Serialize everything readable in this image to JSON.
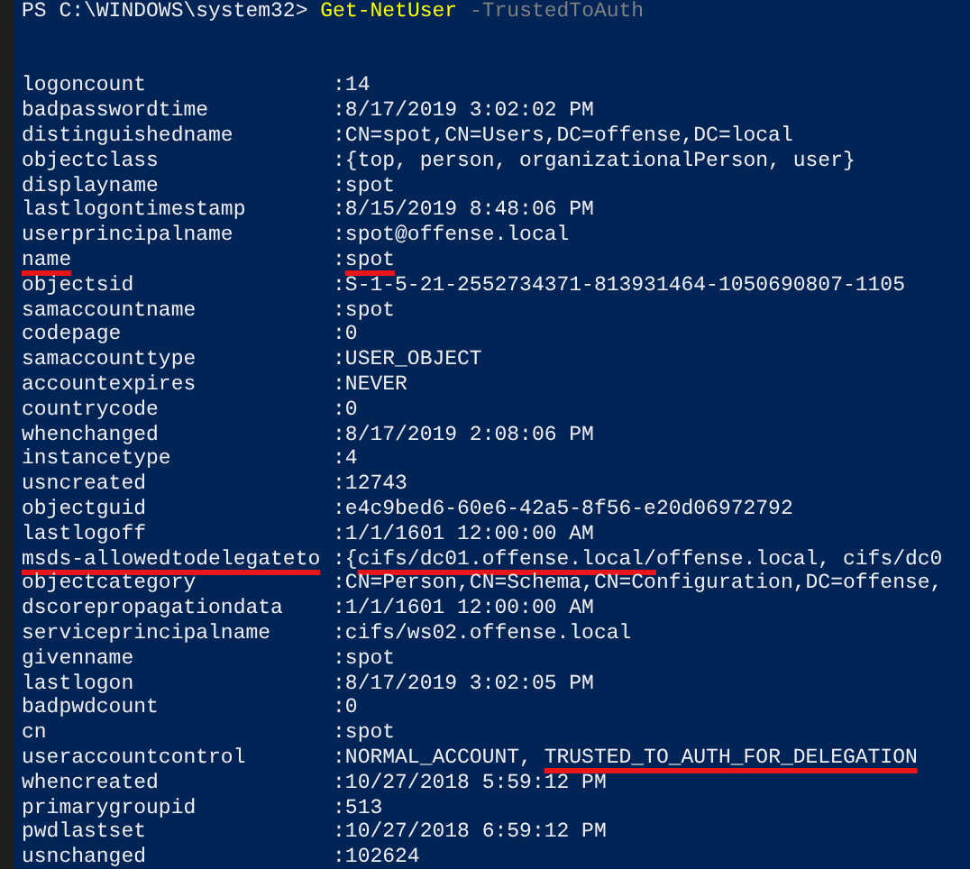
{
  "prompt": [
    {
      "kind": "prompt",
      "text": "PS C:\\WINDOWS\\system32> "
    },
    {
      "kind": "command",
      "text": "Get-NetUser"
    },
    {
      "kind": "parameter",
      "text": " -TrustedToAuth"
    }
  ],
  "rows": [
    {
      "label": "logoncount",
      "separator": ":",
      "value": [
        {
          "text": "14",
          "marked": false
        }
      ],
      "label_marked": false
    },
    {
      "label": "badpasswordtime",
      "separator": ":",
      "value": [
        {
          "text": "8/17/2019 3:02:02 PM",
          "marked": false
        }
      ],
      "label_marked": false
    },
    {
      "label": "distinguishedname",
      "separator": ":",
      "value": [
        {
          "text": "CN=spot,CN=Users,DC=offense,DC=local",
          "marked": false
        }
      ],
      "label_marked": false
    },
    {
      "label": "objectclass",
      "separator": ":",
      "value": [
        {
          "text": "{top, person, organizationalPerson, user}",
          "marked": false
        }
      ],
      "label_marked": false
    },
    {
      "label": "displayname",
      "separator": ":",
      "value": [
        {
          "text": "spot",
          "marked": false
        }
      ],
      "label_marked": false
    },
    {
      "label": "lastlogontimestamp",
      "separator": ":",
      "value": [
        {
          "text": "8/15/2019 8:48:06 PM",
          "marked": false
        }
      ],
      "label_marked": false
    },
    {
      "label": "userprincipalname",
      "separator": ":",
      "value": [
        {
          "text": "spot@offense.local",
          "marked": false
        }
      ],
      "label_marked": false
    },
    {
      "label": "name",
      "separator": ":",
      "value": [
        {
          "text": "spot",
          "marked": true
        }
      ],
      "label_marked": true
    },
    {
      "label": "objectsid",
      "separator": ":",
      "value": [
        {
          "text": "S-1-5-21-2552734371-813931464-1050690807-1105",
          "marked": false
        }
      ],
      "label_marked": false
    },
    {
      "label": "samaccountname",
      "separator": ":",
      "value": [
        {
          "text": "spot",
          "marked": false
        }
      ],
      "label_marked": false
    },
    {
      "label": "codepage",
      "separator": ":",
      "value": [
        {
          "text": "0",
          "marked": false
        }
      ],
      "label_marked": false
    },
    {
      "label": "samaccounttype",
      "separator": ":",
      "value": [
        {
          "text": "USER_OBJECT",
          "marked": false
        }
      ],
      "label_marked": false
    },
    {
      "label": "accountexpires",
      "separator": ":",
      "value": [
        {
          "text": "NEVER",
          "marked": false
        }
      ],
      "label_marked": false
    },
    {
      "label": "countrycode",
      "separator": ":",
      "value": [
        {
          "text": "0",
          "marked": false
        }
      ],
      "label_marked": false
    },
    {
      "label": "whenchanged",
      "separator": ":",
      "value": [
        {
          "text": "8/17/2019 2:08:06 PM",
          "marked": false
        }
      ],
      "label_marked": false
    },
    {
      "label": "instancetype",
      "separator": ":",
      "value": [
        {
          "text": "4",
          "marked": false
        }
      ],
      "label_marked": false
    },
    {
      "label": "usncreated",
      "separator": ":",
      "value": [
        {
          "text": "12743",
          "marked": false
        }
      ],
      "label_marked": false
    },
    {
      "label": "objectguid",
      "separator": ":",
      "value": [
        {
          "text": "e4c9bed6-60e6-42a5-8f56-e20d06972792",
          "marked": false
        }
      ],
      "label_marked": false
    },
    {
      "label": "lastlogoff",
      "separator": ":",
      "value": [
        {
          "text": "1/1/1601 12:00:00 AM",
          "marked": false
        }
      ],
      "label_marked": false
    },
    {
      "label": "msds-allowedtodelegateto",
      "separator": ":",
      "value": [
        {
          "text": "{",
          "marked": false
        },
        {
          "text": "cifs/dc01.offense.local/",
          "marked": true
        },
        {
          "text": "offense.local, cifs/dc0",
          "marked": false
        }
      ],
      "label_marked": true
    },
    {
      "label": "objectcategory",
      "separator": ":",
      "value": [
        {
          "text": "CN=Person,CN=Schema,CN=Configuration,DC=offense,",
          "marked": false
        }
      ],
      "label_marked": false
    },
    {
      "label": "dscorepropagationdata",
      "separator": ":",
      "value": [
        {
          "text": "1/1/1601 12:00:00 AM",
          "marked": false
        }
      ],
      "label_marked": false
    },
    {
      "label": "serviceprincipalname",
      "separator": ":",
      "value": [
        {
          "text": "cifs/ws02.offense.local",
          "marked": false
        }
      ],
      "label_marked": false
    },
    {
      "label": "givenname",
      "separator": ":",
      "value": [
        {
          "text": "spot",
          "marked": false
        }
      ],
      "label_marked": false
    },
    {
      "label": "lastlogon",
      "separator": ":",
      "value": [
        {
          "text": "8/17/2019 3:02:05 PM",
          "marked": false
        }
      ],
      "label_marked": false
    },
    {
      "label": "badpwdcount",
      "separator": ":",
      "value": [
        {
          "text": "0",
          "marked": false
        }
      ],
      "label_marked": false
    },
    {
      "label": "cn",
      "separator": ":",
      "value": [
        {
          "text": "spot",
          "marked": false
        }
      ],
      "label_marked": false
    },
    {
      "label": "useraccountcontrol",
      "separator": ":",
      "value": [
        {
          "text": "NORMAL_ACCOUNT, ",
          "marked": false
        },
        {
          "text": "TRUSTED_TO_AUTH_FOR_DELEGATION",
          "marked": true
        }
      ],
      "label_marked": false
    },
    {
      "label": "whencreated",
      "separator": ":",
      "value": [
        {
          "text": "10/27/2018 5:59:12 PM",
          "marked": false
        }
      ],
      "label_marked": false
    },
    {
      "label": "primarygroupid",
      "separator": ":",
      "value": [
        {
          "text": "513",
          "marked": false
        }
      ],
      "label_marked": false
    },
    {
      "label": "pwdlastset",
      "separator": ":",
      "value": [
        {
          "text": "10/27/2018 6:59:12 PM",
          "marked": false
        }
      ],
      "label_marked": false
    },
    {
      "label": "usnchanged",
      "separator": ":",
      "value": [
        {
          "text": "102624",
          "marked": false
        }
      ],
      "label_marked": false
    }
  ]
}
